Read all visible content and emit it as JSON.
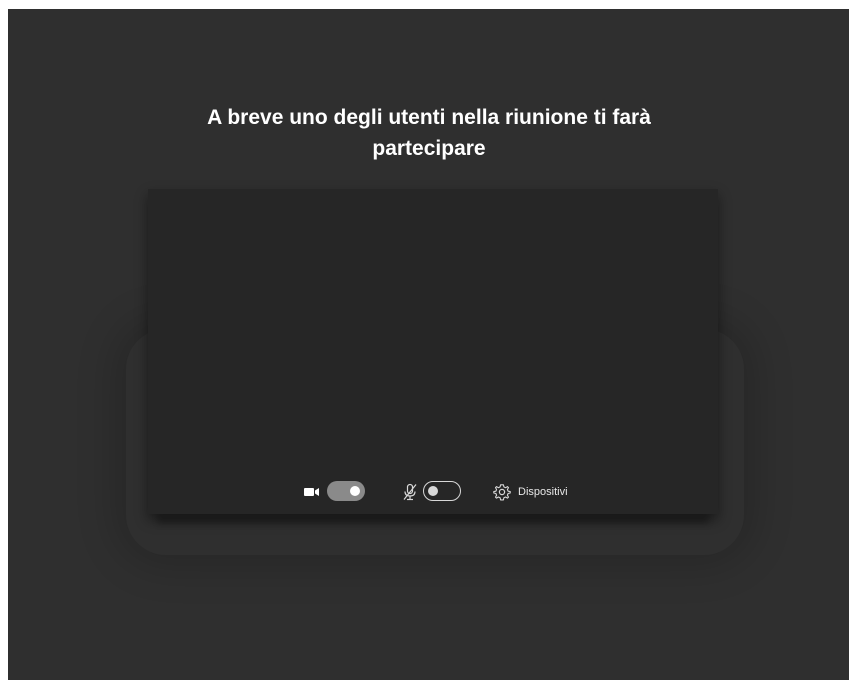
{
  "prejoin": {
    "title_line1": "A breve uno degli utenti nella riunione ti farà",
    "title_line2": "partecipare"
  },
  "controls": {
    "camera": {
      "icon": "camera-icon",
      "state": "on"
    },
    "microphone": {
      "icon": "mic-off-icon",
      "state": "off"
    },
    "devices": {
      "icon": "gear-icon",
      "label": "Dispositivi"
    }
  },
  "colors": {
    "background": "#2f2f2f",
    "preview": "#262626",
    "toggle_on": "#8a8a8a",
    "text": "#ffffff"
  }
}
